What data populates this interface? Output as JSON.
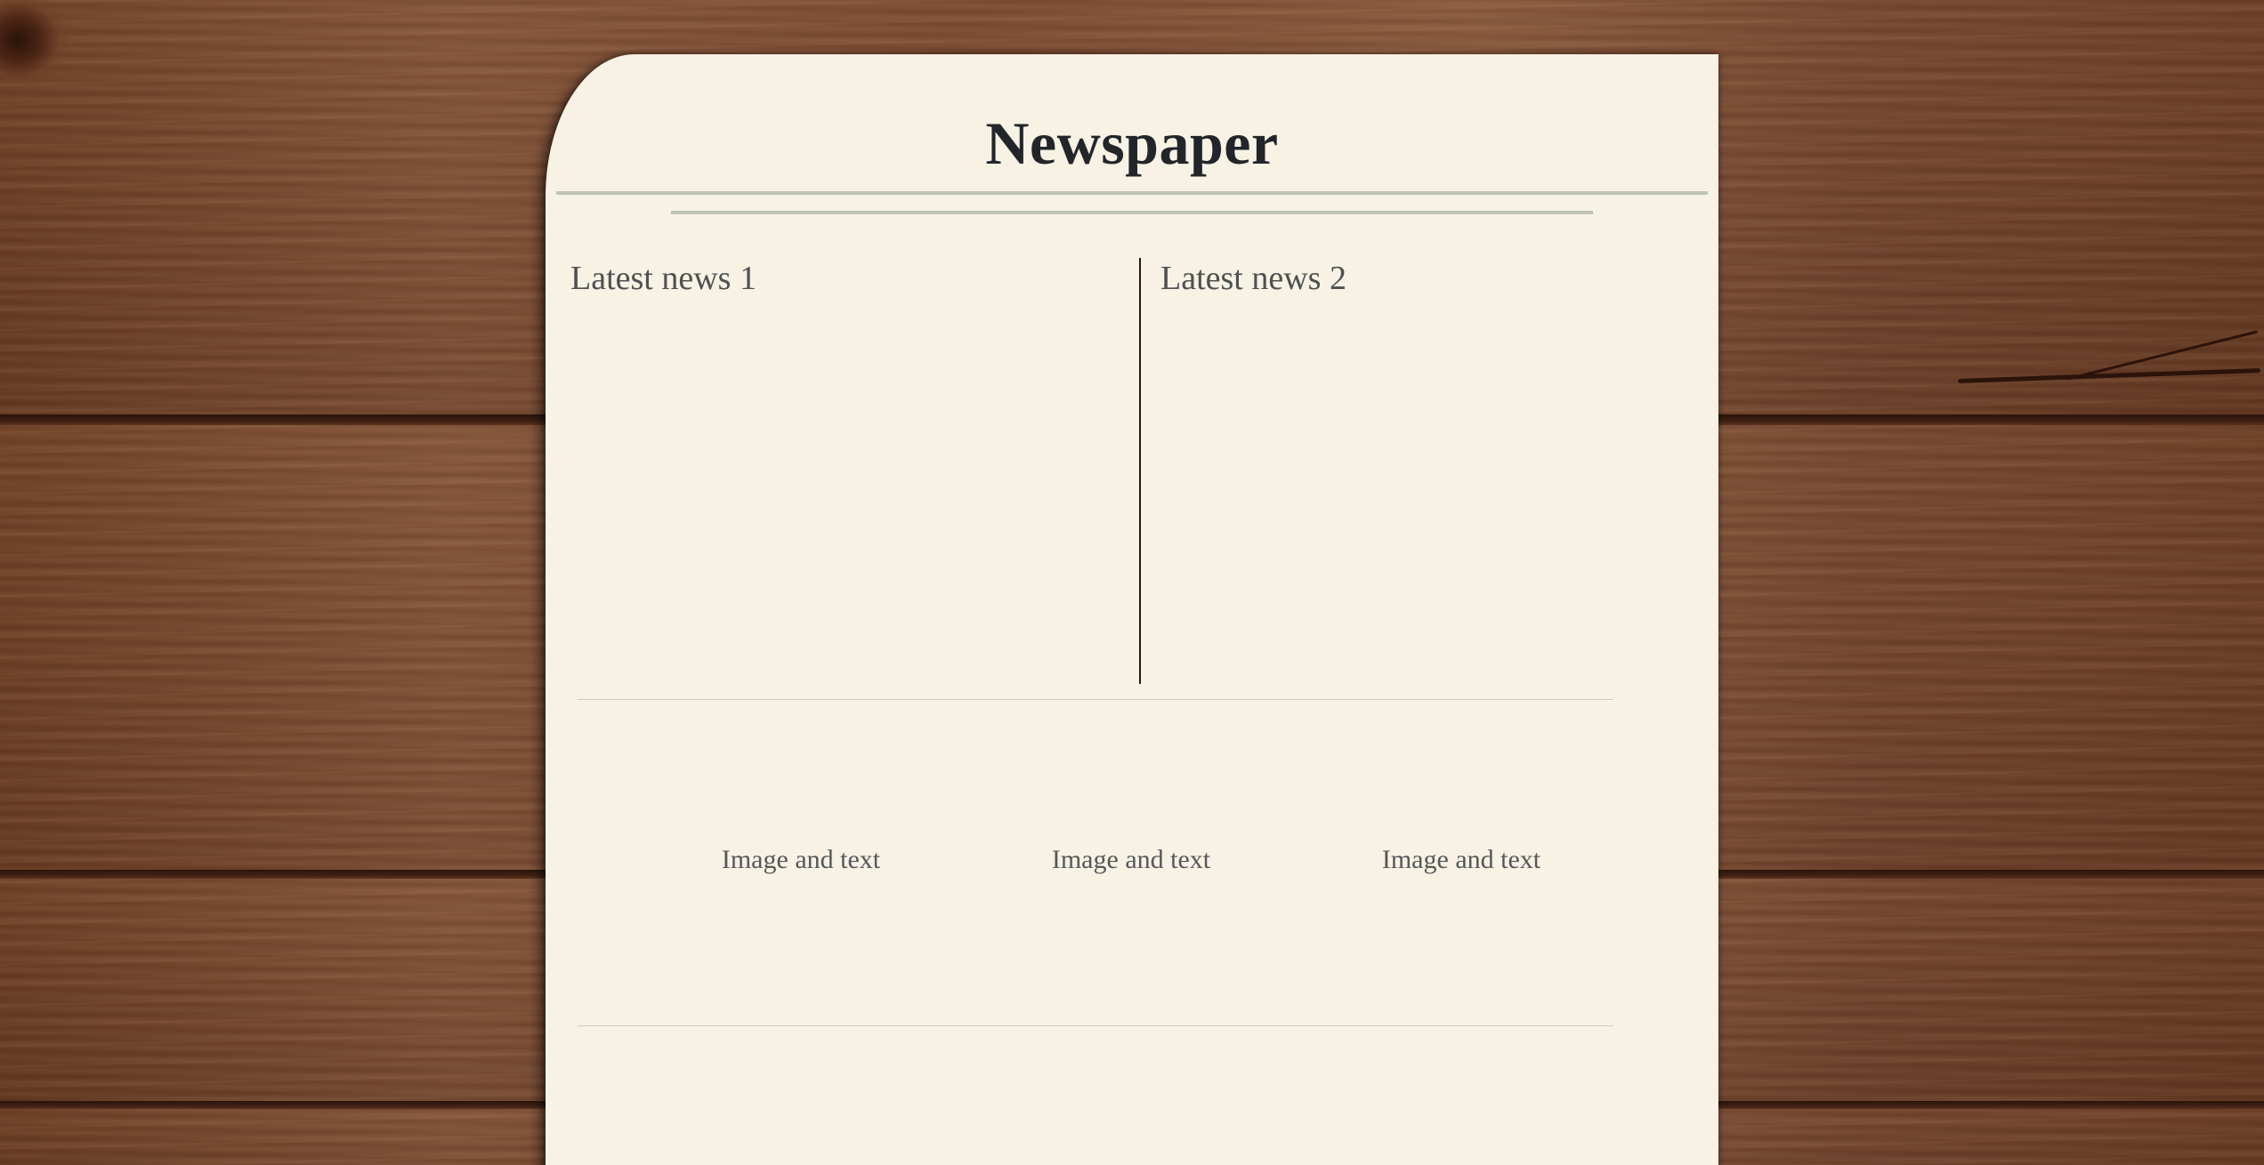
{
  "page": {
    "background": "wooden-table",
    "paper_color": "#f7f2e4",
    "ink_color": "#22262b"
  },
  "newspaper": {
    "masthead": "Newspaper",
    "latest_news": [
      {
        "title": "Latest news 1"
      },
      {
        "title": "Latest news 2"
      }
    ],
    "features": [
      {
        "label": "Image and text"
      },
      {
        "label": "Image and text"
      },
      {
        "label": "Image and text"
      }
    ]
  }
}
